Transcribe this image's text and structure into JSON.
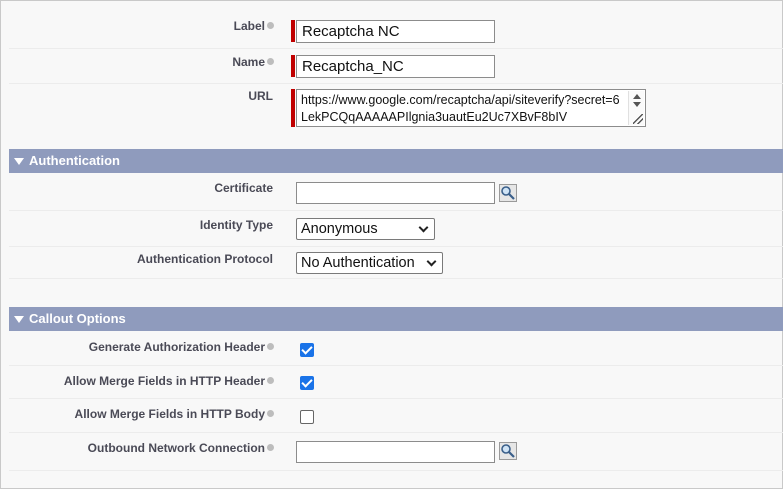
{
  "fields": {
    "label": {
      "label": "Label",
      "value": "Recaptcha NC"
    },
    "name": {
      "label": "Name",
      "value": "Recaptcha_NC"
    },
    "url": {
      "label": "URL",
      "value": "https://www.google.com/recaptcha/api/siteverify?secret=6LekPCQqAAAAAPIlgnia3uautEu2Uc7XBvF8bIV"
    }
  },
  "authentication": {
    "title": "Authentication",
    "certificate": {
      "label": "Certificate",
      "value": ""
    },
    "identity_type": {
      "label": "Identity Type",
      "selected": "Anonymous"
    },
    "auth_protocol": {
      "label": "Authentication Protocol",
      "selected": "No Authentication"
    }
  },
  "callout_options": {
    "title": "Callout Options",
    "generate_auth_header": {
      "label": "Generate Authorization Header",
      "checked": true
    },
    "merge_fields_header": {
      "label": "Allow Merge Fields in HTTP Header",
      "checked": true
    },
    "merge_fields_body": {
      "label": "Allow Merge Fields in HTTP Body",
      "checked": false
    },
    "outbound_network": {
      "label": "Outbound Network Connection",
      "value": ""
    }
  },
  "colors": {
    "section_header": "#8f9bbd",
    "required_bar": "#c00000",
    "checkbox_checked": "#1a73e8"
  },
  "icons": {
    "help": "help-dot-icon",
    "lookup": "magnifier-lookup-icon",
    "section_toggle": "triangle-down-icon"
  }
}
